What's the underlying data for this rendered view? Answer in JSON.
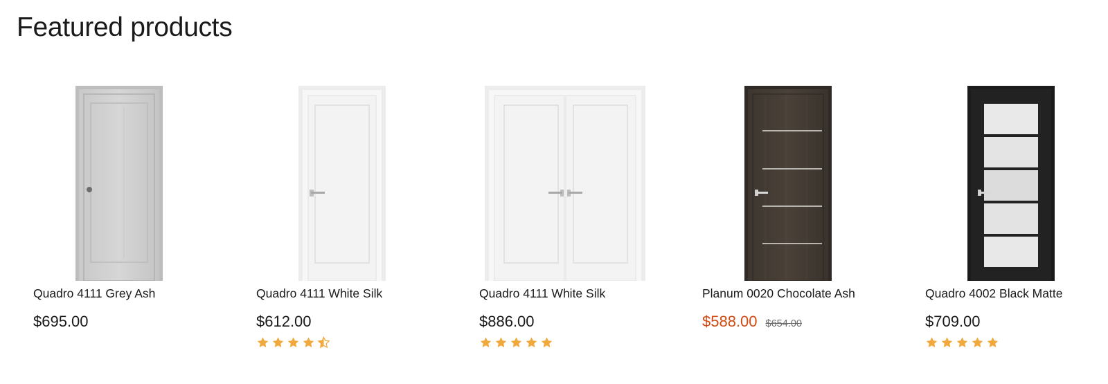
{
  "section": {
    "title": "Featured products"
  },
  "products": [
    {
      "name": "Quadro 4111 Grey Ash",
      "price": "$695.00",
      "compare_price": "",
      "on_sale": false,
      "rating": 0,
      "image": "grey-ash-single-door"
    },
    {
      "name": "Quadro 4111 White Silk",
      "price": "$612.00",
      "compare_price": "",
      "on_sale": false,
      "rating": 4.5,
      "image": "white-silk-single-door"
    },
    {
      "name": "Quadro 4111 White Silk",
      "price": "$886.00",
      "compare_price": "",
      "on_sale": false,
      "rating": 5,
      "image": "white-silk-double-door"
    },
    {
      "name": "Planum 0020 Chocolate Ash",
      "price": "$588.00",
      "compare_price": "$654.00",
      "on_sale": true,
      "rating": 0,
      "image": "chocolate-ash-door"
    },
    {
      "name": "Quadro 4002 Black Matte",
      "price": "$709.00",
      "compare_price": "",
      "on_sale": false,
      "rating": 5,
      "image": "black-matte-glass-door"
    }
  ],
  "colors": {
    "sale_price": "#d24a0f",
    "star": "#f2a93b",
    "text": "#1a1a1a"
  }
}
